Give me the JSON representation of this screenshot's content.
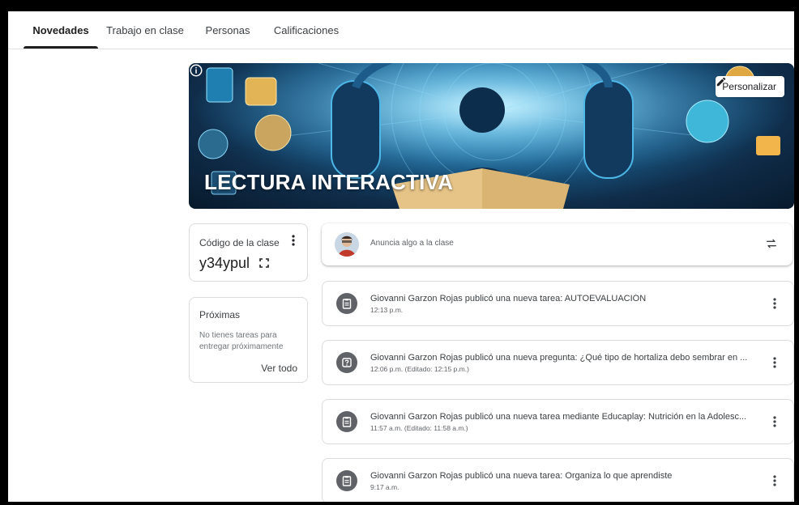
{
  "tabs": [
    {
      "label": "Novedades",
      "active": true
    },
    {
      "label": "Trabajo en clase",
      "active": false
    },
    {
      "label": "Personas",
      "active": false
    },
    {
      "label": "Calificaciones",
      "active": false
    }
  ],
  "banner": {
    "title": "LECTURA INTERACTIVA",
    "customize_label": "Personalizar",
    "icons": {
      "customize": "pencil-icon",
      "info": "info-icon"
    }
  },
  "class_code": {
    "label": "Código de la clase",
    "value": "y34ypul",
    "icons": {
      "more": "more-vert-icon",
      "expand": "fullscreen-icon"
    }
  },
  "upcoming": {
    "title": "Próximas",
    "empty_text": "No tienes tareas para entregar próximamente",
    "view_all_label": "Ver todo"
  },
  "announce": {
    "placeholder": "Anuncia algo a la clase",
    "icons": {
      "repost": "repost-icon",
      "avatar": "avatar"
    }
  },
  "stream": [
    {
      "icon": "assignment-icon",
      "title": "Giovanni Garzon Rojas publicó una nueva tarea: AUTOEVALUACIÓN",
      "time": "12:13 p.m."
    },
    {
      "icon": "question-icon",
      "title": "Giovanni Garzon Rojas publicó una nueva pregunta: ¿Qué tipo de hortaliza debo sembrar en ...",
      "time": "12:06 p.m. (Editado: 12:15 p.m.)"
    },
    {
      "icon": "assignment-icon",
      "title": "Giovanni Garzon Rojas publicó una nueva tarea mediante Educaplay: Nutrición en la Adolesc...",
      "time": "11:57 a.m. (Editado: 11:58 a.m.)"
    },
    {
      "icon": "assignment-icon",
      "title": "Giovanni Garzon Rojas publicó una nueva tarea: Organiza lo que aprendiste",
      "time": "9:17 a.m."
    }
  ],
  "colors": {
    "accent": "#1f1f1f",
    "icon_bg": "#5f6368",
    "border": "#dadce0"
  }
}
